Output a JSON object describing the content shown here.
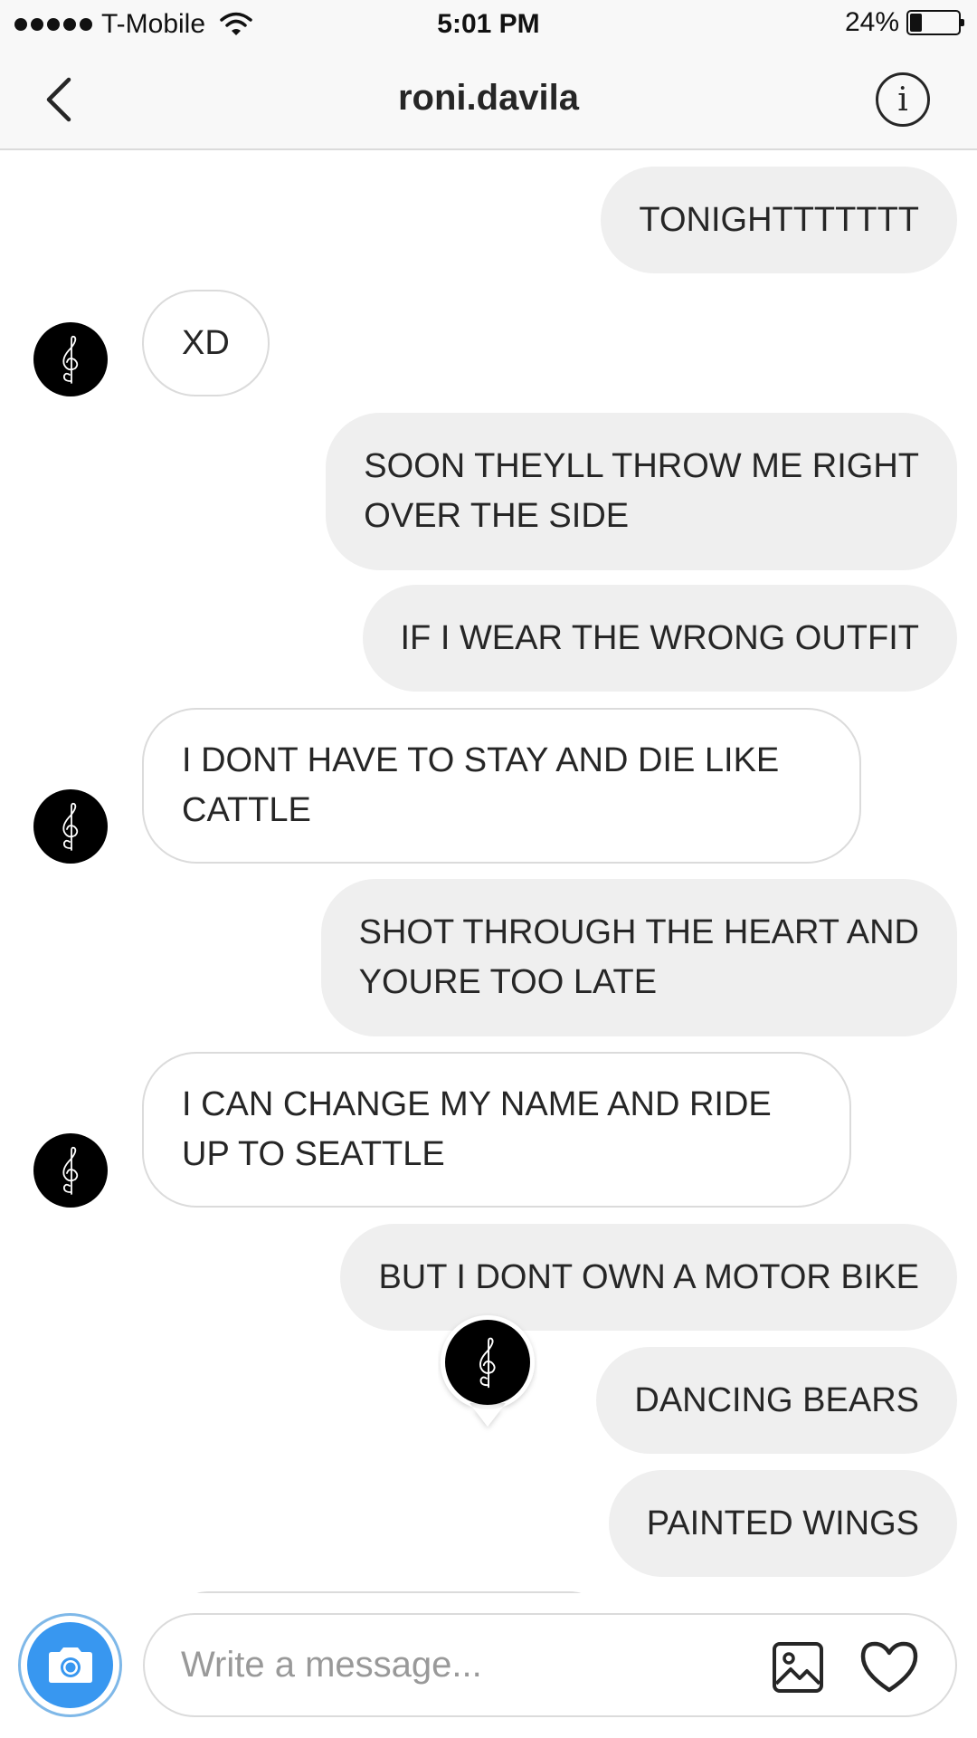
{
  "status_bar": {
    "carrier": "T-Mobile",
    "time": "5:01 PM",
    "battery_percent": "24%",
    "battery_level": 0.24,
    "signal_icon": "signal-dots-icon",
    "wifi_icon": "wifi-icon"
  },
  "header": {
    "title": "roni.davila",
    "back_icon": "chevron-left-icon",
    "info_icon": "info-icon",
    "info_glyph": "i"
  },
  "messages": [
    {
      "direction": "out",
      "text": "TONIGHTTTTTTT"
    },
    {
      "direction": "in",
      "text": "XD"
    },
    {
      "direction": "out",
      "text": "SOON THEYLL THROW ME RIGHT\nOVER THE SIDE"
    },
    {
      "direction": "out",
      "text": "IF I WEAR THE WRONG OUTFIT"
    },
    {
      "direction": "in",
      "text": "I DONT HAVE TO STAY AND DIE LIKE\nCATTLE"
    },
    {
      "direction": "out",
      "text": "SHOT THROUGH THE HEART AND\nYOURE TOO LATE"
    },
    {
      "direction": "in",
      "text": "I CAN CHANGE MY NAME AND RIDE\nUP TO SEATTLE"
    },
    {
      "direction": "out",
      "text": "BUT I DONT OWN A MOTOR BIKE"
    },
    {
      "direction": "out",
      "text": "DANCING BEARS"
    },
    {
      "direction": "out",
      "text": "PAINTED WINGS"
    }
  ],
  "composer": {
    "placeholder": "Write a message...",
    "value": "",
    "camera_icon": "camera-icon",
    "gallery_icon": "image-gallery-icon",
    "heart_icon": "heart-icon"
  },
  "colors": {
    "outgoing_bubble": "#efefef",
    "incoming_border": "#dbdbdb",
    "camera_blue": "#3897f0",
    "avatar_bg": "#000000"
  }
}
